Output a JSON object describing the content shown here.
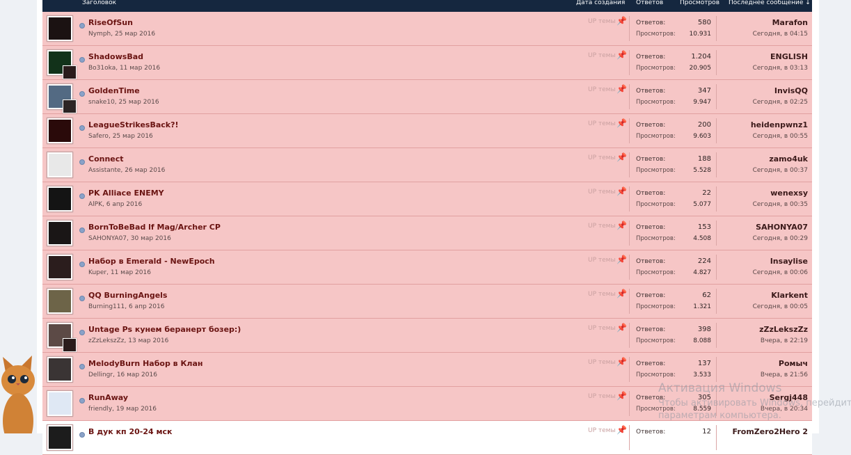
{
  "header": {
    "title": "Заголовок",
    "created": "Дата создания",
    "replies": "Ответов",
    "views": "Просмотров",
    "last_post": "Последнее сообщение ↓"
  },
  "labels": {
    "replies": "Ответов:",
    "views": "Просмотров:",
    "up": "UP темы"
  },
  "threads": [
    {
      "title": "RiseOfSun",
      "author": "Nymph",
      "date": "25 мар 2016",
      "replies": "580",
      "views": "10.931",
      "last_user": "Marafon",
      "last_time": "Сегодня, в 04:15",
      "av": "#1b1212",
      "av2": ""
    },
    {
      "title": "ShadowsBad",
      "author": "Bo31oka",
      "date": "11 мар 2016",
      "replies": "1.204",
      "views": "20.905",
      "last_user": "ENGLISH",
      "last_time": "Сегодня, в 03:13",
      "av": "#12321a",
      "av2": "#2a1c1c"
    },
    {
      "title": "GoldenTime",
      "author": "snake10",
      "date": "25 мар 2016",
      "replies": "347",
      "views": "9.947",
      "last_user": "InvisQQ",
      "last_time": "Сегодня, в 02:25",
      "av": "#536a83",
      "av2": "#2c2424"
    },
    {
      "title": "LeagueStrikesBack?!",
      "author": "Safero",
      "date": "25 мар 2016",
      "replies": "200",
      "views": "9.603",
      "last_user": "heidenpwnz1",
      "last_time": "Сегодня, в 00:55",
      "av": "#2a0a0a",
      "av2": ""
    },
    {
      "title": "Connect",
      "author": "Assistante",
      "date": "26 мар 2016",
      "replies": "188",
      "views": "5.528",
      "last_user": "zamo4uk",
      "last_time": "Сегодня, в 00:37",
      "av": "#e8e8e8",
      "av2": ""
    },
    {
      "title": "PK Alliace ENEMY",
      "author": "AlPK",
      "date": "6 апр 2016",
      "replies": "22",
      "views": "5.077",
      "last_user": "wenexsy",
      "last_time": "Сегодня, в 00:35",
      "av": "#141414",
      "av2": ""
    },
    {
      "title": "BornToBeBad lf Mag/Archer CP",
      "author": "SAHONYA07",
      "date": "30 мар 2016",
      "replies": "153",
      "views": "4.508",
      "last_user": "SAHONYA07",
      "last_time": "Сегодня, в 00:29",
      "av": "#1a1616",
      "av2": ""
    },
    {
      "title": "Набор в Emerald - NewEpoch",
      "author": "Kuper",
      "date": "11 мар 2016",
      "replies": "224",
      "views": "4.827",
      "last_user": "Insaylise",
      "last_time": "Сегодня, в 00:06",
      "av": "#2b1d1d",
      "av2": ""
    },
    {
      "title": "QQ BurningAngels",
      "author": "Burning111",
      "date": "6 апр 2016",
      "replies": "62",
      "views": "1.321",
      "last_user": "Klarkent",
      "last_time": "Сегодня, в 00:05",
      "av": "#6d6448",
      "av2": ""
    },
    {
      "title": "Untage Ps кунем беранерт бозер:)",
      "author": "zZzLekszZz",
      "date": "13 мар 2016",
      "replies": "398",
      "views": "8.088",
      "last_user": "zZzLekszZz",
      "last_time": "Вчера, в 22:19",
      "av": "#5c4a46",
      "av2": "#2a1c1c"
    },
    {
      "title": "MelodyBurn Набор в Клан",
      "author": "Dellingr",
      "date": "16 мар 2016",
      "replies": "137",
      "views": "3.533",
      "last_user": "Ромыч",
      "last_time": "Вчера, в 21:56",
      "av": "#3a3434",
      "av2": ""
    },
    {
      "title": "RunAway",
      "author": "friendly",
      "date": "19 мар 2016",
      "replies": "305",
      "views": "8.559",
      "last_user": "Sergj448",
      "last_time": "Вчера, в 20:34",
      "av": "#dfe8f4",
      "av2": ""
    },
    {
      "title": "В дук кп 20-24 мск",
      "author": "",
      "date": "",
      "replies": "12",
      "views": "",
      "last_user": "FromZero2Hero 2",
      "last_time": "",
      "av": "#1c1c1c",
      "av2": "",
      "plain": true
    }
  ],
  "watermark": {
    "line1": "Активация Windows",
    "line2": "Чтобы активировать Windows, перейдите к",
    "line3": "параметрам компьютера."
  }
}
